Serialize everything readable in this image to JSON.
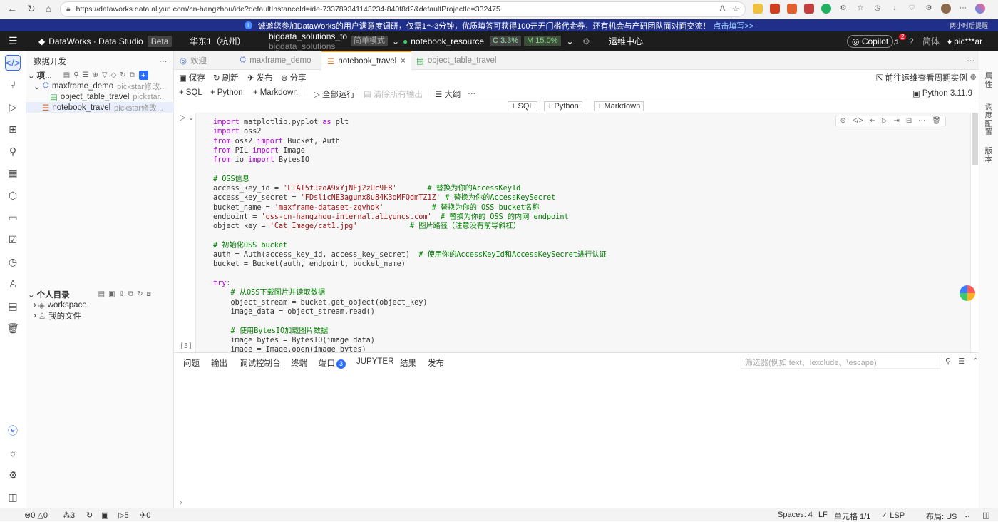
{
  "browser": {
    "url": "https://dataworks.data.aliyun.com/cn-hangzhou/ide?defaultInstanceId=ide-733789341143234-840f8d2&defaultProjectId=332475"
  },
  "banner": {
    "text": "诚邀您参加DataWorks的用户满意度调研，仅需1～3分钟，优质填答可获得100元无门槛代金券，还有机会与产研团队面对面交流！",
    "link": "点击填写>>",
    "remind": "两小时后提醒"
  },
  "header": {
    "product": "DataWorks · Data Studio",
    "beta": "Beta",
    "region": "华东1（杭州）",
    "project_line1": "bigdata_solutions_to",
    "project_line2": "bigdata_solutions",
    "mode": "简单模式",
    "resource": "notebook_resource",
    "cpu": "C 3.3%",
    "mem": "M 15.0%",
    "ops": "运维中心",
    "copilot": "Copilot",
    "notif_count": "2",
    "lang": "简体",
    "user": "pic***ar"
  },
  "explorer": {
    "title": "数据开发",
    "project_label": "项...",
    "items": [
      {
        "name": "maxframe_demo",
        "meta": "pickstar修改..."
      },
      {
        "name": "object_table_travel",
        "meta": "pickstar..."
      },
      {
        "name": "notebook_travel",
        "meta": "pickstar修改..."
      }
    ],
    "personal": "个人目录",
    "personal_items": [
      "workspace",
      "我的文件"
    ]
  },
  "tabs": [
    "欢迎",
    "maxframe_demo",
    "notebook_travel",
    "object_table_travel"
  ],
  "toolbar": {
    "save": "保存",
    "refresh": "刷新",
    "publish": "发布",
    "share": "分享",
    "goto_ops": "前往运维查看周期实例",
    "add_sql": "SQL",
    "add_python": "Python",
    "add_markdown": "Markdown",
    "run_all": "全部运行",
    "clear_output": "清除所有输出",
    "outline": "大纲",
    "kernel": "Python 3.11.9"
  },
  "cell": {
    "exec_count": "[3]"
  },
  "panel": {
    "tabs": [
      "问题",
      "输出",
      "调试控制台",
      "终端",
      "端口",
      "JUPYTER",
      "结果",
      "发布"
    ],
    "port_count": "3",
    "filter_placeholder": "筛选器(例如 text、!exclude、\\escape)"
  },
  "right_rail": [
    "属性",
    "调度配置",
    "版本"
  ],
  "status": {
    "errors": "0",
    "warnings": "0",
    "ports": "3",
    "run": "5",
    "pub": "0",
    "spaces": "Spaces: 4",
    "eol": "LF",
    "cells": "单元格 1/1",
    "lsp": "LSP",
    "layout": "布局: US"
  }
}
